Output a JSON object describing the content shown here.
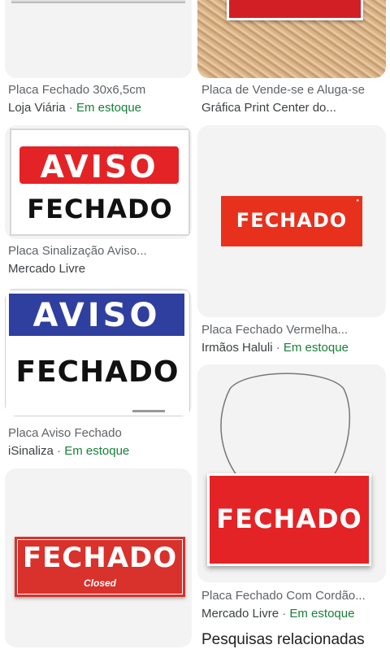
{
  "results": [
    {
      "title": "Placa Fechado 30x6,5cm",
      "source": "Loja Viária",
      "stock": "Em estoque"
    },
    {
      "title": "Placa de Vende-se e Aluga-se",
      "source": "Gráfica Print Center do...",
      "stock": ""
    },
    {
      "title": "Placa Sinalização Aviso...",
      "source": "Mercado Livre",
      "stock": "",
      "sign_top": "AVISO",
      "sign_bottom": "FECHADO"
    },
    {
      "title": "Placa Fechado Vermelha...",
      "source": "Irmãos Haluli",
      "stock": "Em estoque",
      "sign_text": "FECHADO"
    },
    {
      "title": "Placa Aviso Fechado",
      "source": "iSinaliza",
      "stock": "Em estoque",
      "sign_top": "AVISO",
      "sign_bottom": "FECHADO"
    },
    {
      "title": "Placa Fechado Com Cordão...",
      "source": "Mercado Livre",
      "stock": "Em estoque",
      "sign_text": "FECHADO"
    },
    {
      "title": "",
      "source": "",
      "stock": "",
      "sign_text": "FECHADO",
      "sign_sub": "Closed"
    }
  ],
  "separator": "·",
  "related_heading": "Pesquisas relacionadas",
  "colors": {
    "sign_red": "#e42326",
    "sign_blue": "#2e3fa0",
    "stock_green": "#188038"
  }
}
